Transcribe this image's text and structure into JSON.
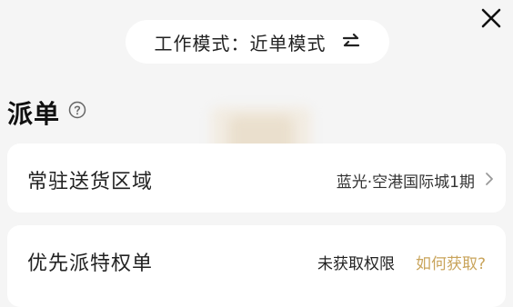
{
  "header": {
    "mode_label": "工作模式：近单模式",
    "swap_icon": "swap-arrows-icon",
    "close_icon": "close-icon"
  },
  "section": {
    "title": "派单",
    "help_icon": "help-circle-icon"
  },
  "rows": {
    "delivery_area": {
      "label": "常驻送货区域",
      "value": "蓝光·空港国际城1期",
      "chevron_icon": "chevron-right-icon"
    },
    "priority_order": {
      "label": "优先派特权单",
      "status": "未获取权限",
      "link": "如何获取?"
    }
  },
  "colors": {
    "background": "#f5f5f5",
    "card": "#ffffff",
    "link": "#c9a45b"
  }
}
